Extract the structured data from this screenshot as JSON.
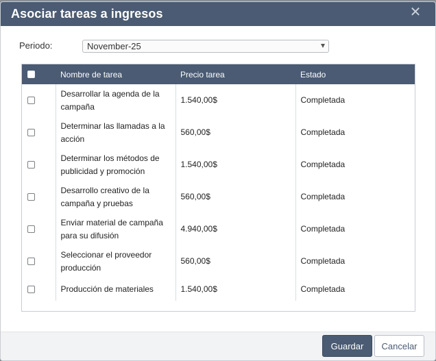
{
  "dialog": {
    "title": "Asociar tareas a ingresos",
    "close_symbol": "✕"
  },
  "period": {
    "label": "Periodo:",
    "selected": "November-25"
  },
  "table": {
    "headers": {
      "name": "Nombre de tarea",
      "price": "Precio tarea",
      "state": "Estado"
    },
    "rows": [
      {
        "name": "Desarrollar la agenda de la campaña",
        "price": "1.540,00$",
        "state": "Completada",
        "checked": false
      },
      {
        "name": "Determinar las llamadas a la acción",
        "price": "560,00$",
        "state": "Completada",
        "checked": false
      },
      {
        "name": "Determinar los métodos de publicidad y promoción",
        "price": "1.540,00$",
        "state": "Completada",
        "checked": false
      },
      {
        "name": "Desarrollo creativo de la campaña y pruebas",
        "price": "560,00$",
        "state": "Completada",
        "checked": false
      },
      {
        "name": "Enviar material de campaña para su difusión",
        "price": "4.940,00$",
        "state": "Completada",
        "checked": false
      },
      {
        "name": "Seleccionar el proveedor producción",
        "price": "560,00$",
        "state": "Completada",
        "checked": false
      },
      {
        "name": "Producción de materiales",
        "price": "1.540,00$",
        "state": "Completada",
        "checked": false
      }
    ]
  },
  "footer": {
    "save_label": "Guardar",
    "cancel_label": "Cancelar"
  },
  "colors": {
    "header_bg": "#4a5b73",
    "primary_button": "#4a5b73",
    "backdrop": "#7d8288"
  }
}
